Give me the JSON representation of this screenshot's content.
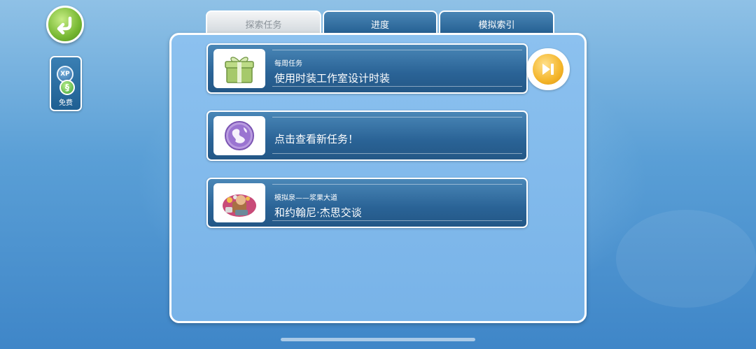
{
  "tabs": [
    {
      "label": "探索任务",
      "active": true
    },
    {
      "label": "进度",
      "active": false
    },
    {
      "label": "模拟索引",
      "active": false
    }
  ],
  "sidebar": {
    "reward": {
      "xp_label": "XP",
      "simoleon_symbol": "§",
      "label": "免费"
    }
  },
  "tasks": [
    {
      "subtitle": "每周任务",
      "title": "使用时装工作室设计时装",
      "icon": "gift-box-icon"
    },
    {
      "subtitle": "",
      "title": "点击查看新任务！",
      "icon": "globe-icon"
    },
    {
      "subtitle": "模拟泉——浆果大道",
      "title": "和约翰尼·杰思交谈",
      "icon": "character-portrait-icon"
    }
  ],
  "colors": {
    "back_button": "#77b832",
    "skip_button": "#f4b52a",
    "panel": "#78b3e8",
    "task_bar": "#2a6396"
  }
}
